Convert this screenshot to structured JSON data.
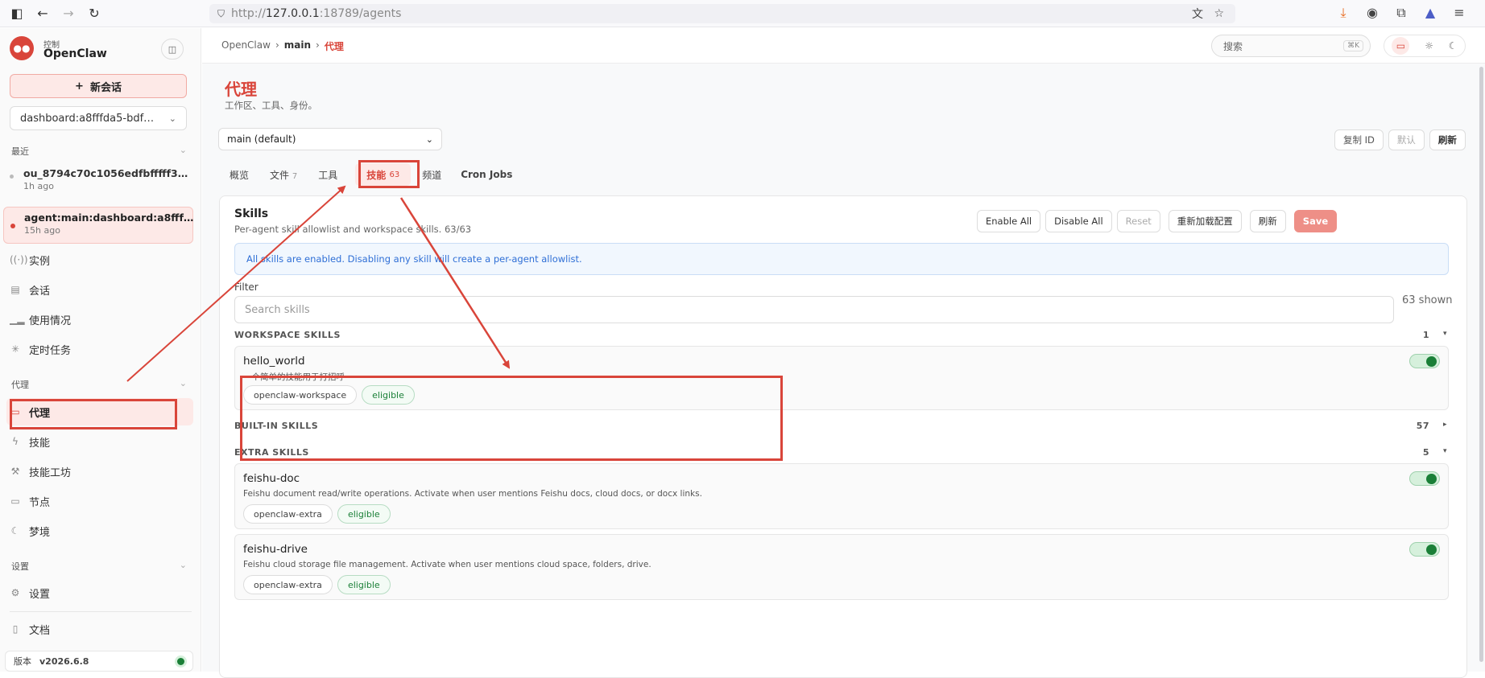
{
  "browser": {
    "url_prefix": "http://",
    "url_host": "127.0.0.1",
    "url_rest": ":18789/agents"
  },
  "sidebar": {
    "brand_sub": "控制",
    "brand_name": "OpenClaw",
    "new_session": "新会话",
    "session_select": "dashboard:a8fffda5-bdf…",
    "recent_label": "最近",
    "recent": [
      {
        "title": "ou_8794c70c1056edfbfffff3…",
        "time": "1h ago"
      },
      {
        "title": "agent:main:dashboard:a8fff…",
        "time": "15h ago"
      }
    ],
    "items_main": [
      {
        "label": "实例",
        "icon": "broadcast-icon"
      },
      {
        "label": "会话",
        "icon": "document-icon"
      },
      {
        "label": "使用情况",
        "icon": "bar-chart-icon"
      },
      {
        "label": "定时任务",
        "icon": "loader-icon"
      }
    ],
    "agent_section": "代理",
    "items_agent": [
      {
        "label": "代理",
        "icon": "folder-icon"
      },
      {
        "label": "技能",
        "icon": "bolt-icon"
      },
      {
        "label": "技能工坊",
        "icon": "wrench-icon"
      },
      {
        "label": "节点",
        "icon": "monitor-icon"
      },
      {
        "label": "梦境",
        "icon": "moon-icon"
      }
    ],
    "settings_section": "设置",
    "settings_item": "设置",
    "docs_item": "文档",
    "version_label": "版本",
    "version_value": "v2026.6.8"
  },
  "topbar": {
    "breadcrumb": [
      "OpenClaw",
      "main",
      "代理"
    ],
    "search_placeholder": "搜索",
    "search_shortcut": "⌘K"
  },
  "page": {
    "title": "代理",
    "subtitle": "工作区、工具、身份。",
    "agent_select": "main (default)",
    "copy_id": "复制 ID",
    "default_btn": "默认",
    "refresh_btn": "刷新",
    "tabs": [
      {
        "label": "概览",
        "count": ""
      },
      {
        "label": "文件",
        "count": "7"
      },
      {
        "label": "工具",
        "count": ""
      },
      {
        "label": "技能",
        "count": "63"
      },
      {
        "label": "频道",
        "count": ""
      },
      {
        "label": "Cron Jobs",
        "count": ""
      }
    ]
  },
  "skills": {
    "title": "Skills",
    "desc": "Per-agent skill allowlist and workspace skills. 63/63",
    "buttons": {
      "enable_all": "Enable All",
      "disable_all": "Disable All",
      "reset": "Reset",
      "reload": "重新加载配置",
      "refresh": "刷新",
      "save": "Save"
    },
    "notice": "All skills are enabled. Disabling any skill will create a per-agent allowlist.",
    "filter_label": "Filter",
    "filter_placeholder": "Search skills",
    "shown": "63 shown",
    "groups": {
      "workspace": {
        "label": "WORKSPACE SKILLS",
        "count": "1",
        "caret": "▾"
      },
      "builtin": {
        "label": "BUILT-IN SKILLS",
        "count": "57",
        "caret": "▸"
      },
      "extra": {
        "label": "EXTRA SKILLS",
        "count": "5",
        "caret": "▾"
      }
    },
    "items": [
      {
        "name": "hello_world",
        "desc": "一个简单的技能用于打招呼",
        "source": "openclaw-workspace",
        "status": "eligible"
      },
      {
        "name": "feishu-doc",
        "desc": "Feishu document read/write operations. Activate when user mentions Feishu docs, cloud docs, or docx links.",
        "source": "openclaw-extra",
        "status": "eligible"
      },
      {
        "name": "feishu-drive",
        "desc": "Feishu cloud storage file management. Activate when user mentions cloud space, folders, drive.",
        "source": "openclaw-extra",
        "status": "eligible"
      }
    ]
  },
  "colors": {
    "accent": "#d9453a",
    "success": "#1a7f37",
    "notice_bg": "#f1f7fe",
    "notice_text": "#2f6fd6"
  }
}
